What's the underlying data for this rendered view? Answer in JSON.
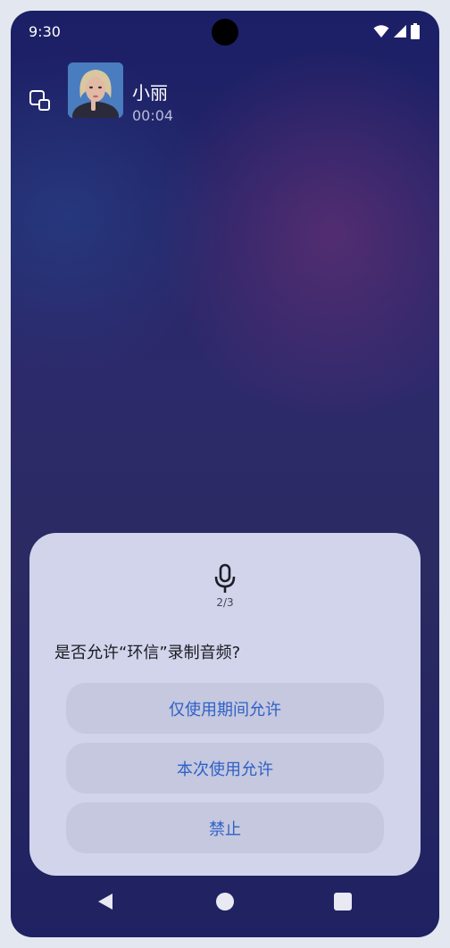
{
  "status_bar": {
    "time": "9:30",
    "icons": [
      "wifi-icon",
      "signal-icon",
      "battery-icon"
    ]
  },
  "call": {
    "caller_name": "小丽",
    "duration": "00:04",
    "float_icon": "floating-window-icon"
  },
  "permission_dialog": {
    "icon": "microphone-icon",
    "step": "2/3",
    "question": "是否允许“环信”录制音频?",
    "options": [
      {
        "label": "仅使用期间允许"
      },
      {
        "label": "本次使用允许"
      },
      {
        "label": "禁止"
      }
    ],
    "accent_color": "#2f60c8"
  },
  "nav_bar": {
    "icons": [
      "back-icon",
      "home-icon",
      "recents-icon"
    ]
  }
}
